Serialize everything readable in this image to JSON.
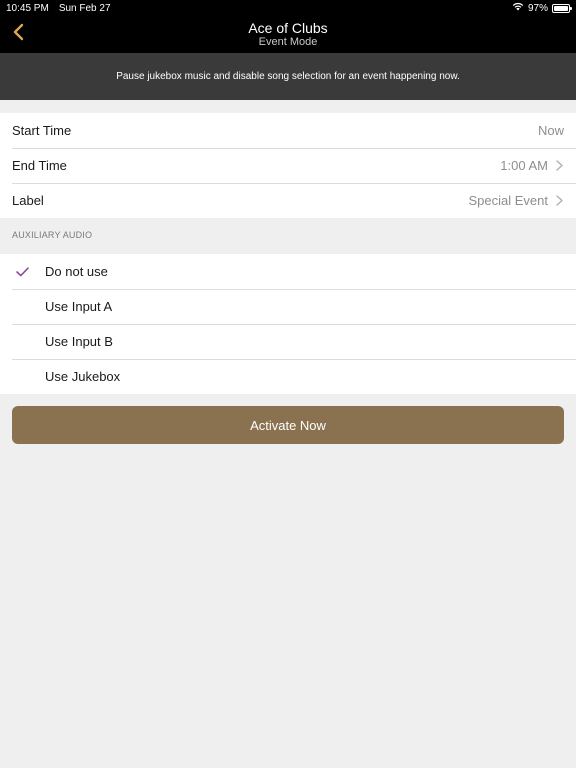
{
  "status_bar": {
    "time": "10:45 PM",
    "date": "Sun Feb 27",
    "battery": "97%",
    "battery_level": 0.97
  },
  "nav": {
    "title": "Ace of Clubs",
    "subtitle": "Event Mode",
    "back_icon": "chevron-left-icon",
    "accent_color": "#d9a55b"
  },
  "banner": {
    "text": "Pause jukebox music and disable song selection for an event happening now."
  },
  "settings": {
    "start_time": {
      "label": "Start Time",
      "value": "Now"
    },
    "end_time": {
      "label": "End Time",
      "value": "1:00 AM"
    },
    "label": {
      "label": "Label",
      "value": "Special Event"
    }
  },
  "auxiliary_audio": {
    "header": "AUXILIARY AUDIO",
    "options": [
      {
        "label": "Do not use",
        "selected": true
      },
      {
        "label": "Use Input A",
        "selected": false
      },
      {
        "label": "Use Input B",
        "selected": false
      },
      {
        "label": "Use Jukebox",
        "selected": false
      }
    ],
    "check_color": "#8e4a9e"
  },
  "actions": {
    "activate_label": "Activate Now",
    "button_color": "#8a7250"
  }
}
